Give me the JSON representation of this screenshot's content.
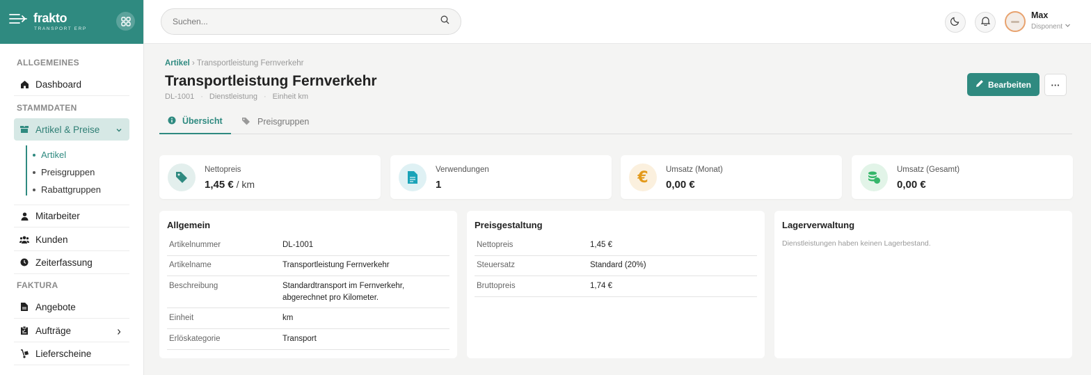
{
  "brand": {
    "name": "frakto",
    "sub": "TRANSPORT ERP"
  },
  "sidebar": {
    "sections": [
      "ALLGEMEINES",
      "STAMMDATEN",
      "FAKTURA"
    ],
    "items": {
      "dashboard": "Dashboard",
      "artikel_preise": "Artikel & Preise",
      "mitarbeiter": "Mitarbeiter",
      "kunden": "Kunden",
      "zeiterfassung": "Zeiterfassung",
      "angebote": "Angebote",
      "auftraege": "Aufträge",
      "lieferscheine": "Lieferscheine"
    },
    "subitems": [
      "Artikel",
      "Preisgruppen",
      "Rabattgruppen"
    ]
  },
  "search": {
    "placeholder": "Suchen..."
  },
  "user": {
    "name": "Max",
    "role": "Disponent"
  },
  "breadcrumb": {
    "parent": "Artikel",
    "current": "Transportleistung Fernverkehr"
  },
  "page": {
    "title": "Transportleistung Fernverkehr",
    "meta": [
      "DL-1001",
      "Dienstleistung",
      "Einheit km"
    ],
    "edit_label": "Bearbeiten",
    "more_label": "···"
  },
  "tabs": [
    "Übersicht",
    "Preisgruppen"
  ],
  "stats": [
    {
      "label": "Nettopreis",
      "value": "1,45 €",
      "unit": " / km",
      "color": "#2f8a80",
      "icon": "tag-icon"
    },
    {
      "label": "Verwendungen",
      "value": "1",
      "unit": "",
      "color": "#1aa3b8",
      "icon": "document-icon"
    },
    {
      "label": "Umsatz (Monat)",
      "value": "0,00 €",
      "unit": "",
      "color": "#e39a1c",
      "icon": "euro-icon"
    },
    {
      "label": "Umsatz (Gesamt)",
      "value": "0,00 €",
      "unit": "",
      "color": "#35b66a",
      "icon": "coins-icon"
    }
  ],
  "allgemein": {
    "title": "Allgemein",
    "rows": [
      {
        "k": "Artikelnummer",
        "v": "DL-1001"
      },
      {
        "k": "Artikelname",
        "v": "Transportleistung Fernverkehr"
      },
      {
        "k": "Beschreibung",
        "v": "Standardtransport im Fernverkehr, abgerechnet pro Kilometer."
      },
      {
        "k": "Einheit",
        "v": "km"
      },
      {
        "k": "Erlöskategorie",
        "v": "Transport"
      }
    ]
  },
  "preis": {
    "title": "Preisgestaltung",
    "rows": [
      {
        "k": "Nettopreis",
        "v": "1,45 €"
      },
      {
        "k": "Steuersatz",
        "v": "Standard (20%)"
      },
      {
        "k": "Bruttopreis",
        "v": "1,74 €"
      }
    ]
  },
  "lager": {
    "title": "Lagerverwaltung",
    "note": "Dienstleistungen haben keinen Lagerbestand."
  }
}
